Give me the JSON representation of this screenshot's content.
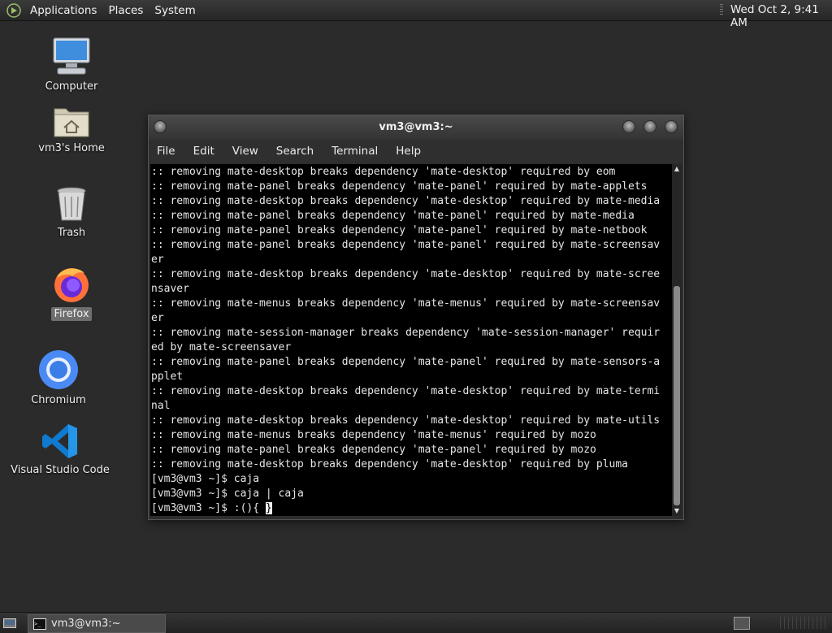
{
  "top_panel": {
    "menus": [
      "Applications",
      "Places",
      "System"
    ],
    "clock": "Wed Oct  2,  9:41 AM"
  },
  "desktop": {
    "icons": [
      {
        "label": "Computer",
        "icon": "computer-icon"
      },
      {
        "label": "vm3's Home",
        "icon": "home-folder-icon"
      },
      {
        "label": "Trash",
        "icon": "trash-icon"
      },
      {
        "label": "Firefox",
        "icon": "firefox-icon"
      },
      {
        "label": "Chromium",
        "icon": "chromium-icon"
      },
      {
        "label": "Visual Studio Code",
        "icon": "vscode-icon"
      }
    ]
  },
  "terminal": {
    "title": "vm3@vm3:~",
    "menu": [
      "File",
      "Edit",
      "View",
      "Search",
      "Terminal",
      "Help"
    ],
    "lines": [
      ":: removing mate-desktop breaks dependency 'mate-desktop' required by eom",
      ":: removing mate-panel breaks dependency 'mate-panel' required by mate-applets",
      ":: removing mate-desktop breaks dependency 'mate-desktop' required by mate-media",
      ":: removing mate-panel breaks dependency 'mate-panel' required by mate-media",
      ":: removing mate-panel breaks dependency 'mate-panel' required by mate-netbook",
      ":: removing mate-panel breaks dependency 'mate-panel' required by mate-screensav",
      "er",
      ":: removing mate-desktop breaks dependency 'mate-desktop' required by mate-scree",
      "nsaver",
      ":: removing mate-menus breaks dependency 'mate-menus' required by mate-screensav",
      "er",
      ":: removing mate-session-manager breaks dependency 'mate-session-manager' requir",
      "ed by mate-screensaver",
      ":: removing mate-panel breaks dependency 'mate-panel' required by mate-sensors-a",
      "pplet",
      ":: removing mate-desktop breaks dependency 'mate-desktop' required by mate-termi",
      "nal",
      ":: removing mate-desktop breaks dependency 'mate-desktop' required by mate-utils",
      ":: removing mate-menus breaks dependency 'mate-menus' required by mozo",
      ":: removing mate-panel breaks dependency 'mate-panel' required by mozo",
      ":: removing mate-desktop breaks dependency 'mate-desktop' required by pluma",
      "[vm3@vm3 ~]$ caja",
      "[vm3@vm3 ~]$ caja | caja"
    ],
    "prompt_line": "[vm3@vm3 ~]$ :(){ ",
    "cursor_char": "}"
  },
  "bottom_panel": {
    "task_label": "vm3@vm3:~"
  }
}
